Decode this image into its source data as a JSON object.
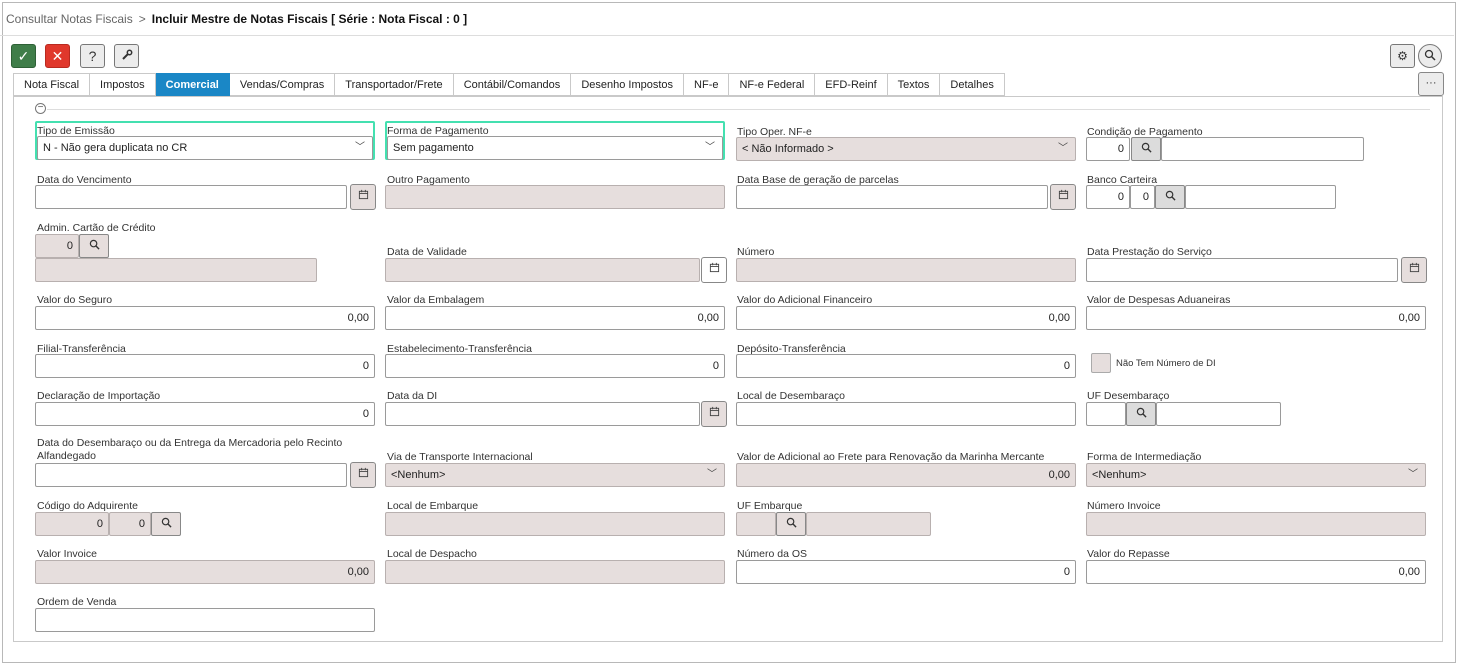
{
  "breadcrumb": {
    "parent": "Consultar Notas Fiscais",
    "separator": ">",
    "current": "Incluir Mestre de Notas Fiscais [ Série : Nota Fiscal : 0 ]"
  },
  "toolbar": {
    "ok": "✓",
    "cancel": "✕",
    "help": "?",
    "tools": "⚙",
    "gear": "⚙",
    "search": "⌕",
    "more": "···"
  },
  "tabs": [
    "Nota Fiscal",
    "Impostos",
    "Comercial",
    "Vendas/Compras",
    "Transportador/Frete",
    "Contábil/Comandos",
    "Desenho Impostos",
    "NF-e",
    "NF-e Federal",
    "EFD-Reinf",
    "Textos",
    "Detalhes"
  ],
  "active_tab": "Comercial",
  "collapse": "−",
  "icons": {
    "calendar": "📅",
    "search": "🔍",
    "caret": "﹀"
  },
  "fields": {
    "tipo_emissao": {
      "label": "Tipo de Emissão",
      "value": "N - Não gera duplicata no CR"
    },
    "forma_pagamento": {
      "label": "Forma de Pagamento",
      "value": "Sem pagamento"
    },
    "tipo_oper_nfe": {
      "label": "Tipo Oper. NF-e",
      "value": "< Não Informado >"
    },
    "condicao_pagamento": {
      "label": "Condição de Pagamento",
      "code": "0",
      "desc": ""
    },
    "data_vencimento": {
      "label": "Data do Vencimento",
      "value": ""
    },
    "outro_pagamento": {
      "label": "Outro Pagamento",
      "value": ""
    },
    "data_base_parcelas": {
      "label": "Data Base de geração de parcelas",
      "value": ""
    },
    "banco_carteira": {
      "label": "Banco Carteira",
      "code1": "0",
      "code2": "0",
      "desc": ""
    },
    "admin_cartao": {
      "label": "Admin. Cartão de Crédito",
      "code": "0",
      "desc": ""
    },
    "data_validade": {
      "label": "Data de Validade",
      "value": ""
    },
    "numero": {
      "label": "Número",
      "value": ""
    },
    "data_prestacao": {
      "label": "Data Prestação do Serviço",
      "value": ""
    },
    "valor_seguro": {
      "label": "Valor do Seguro",
      "value": "0,00"
    },
    "valor_embalagem": {
      "label": "Valor da Embalagem",
      "value": "0,00"
    },
    "valor_adicional_financeiro": {
      "label": "Valor do Adicional Financeiro",
      "value": "0,00"
    },
    "valor_despesas_aduaneiras": {
      "label": "Valor de Despesas Aduaneiras",
      "value": "0,00"
    },
    "filial_transferencia": {
      "label": "Filial-Transferência",
      "value": "0"
    },
    "estabelecimento_transferencia": {
      "label": "Estabelecimento-Transferência",
      "value": "0"
    },
    "deposito_transferencia": {
      "label": "Depósito-Transferência",
      "value": "0"
    },
    "nao_tem_numero_di": {
      "label": "Não Tem Número de DI",
      "checked": false
    },
    "declaracao_importacao": {
      "label": "Declaração de Importação",
      "value": "0"
    },
    "data_di": {
      "label": "Data da DI",
      "value": ""
    },
    "local_desembaraco": {
      "label": "Local de Desembaraço",
      "value": ""
    },
    "uf_desembaraco": {
      "label": "UF Desembaraço",
      "code": "",
      "desc": ""
    },
    "data_desembaraco": {
      "label_line1": "Data do Desembaraço ou da Entrega da Mercadoria pelo Recinto",
      "label_line2": "Alfandegado",
      "value": ""
    },
    "via_transporte": {
      "label": "Via de Transporte Internacional",
      "value": "<Nenhum>"
    },
    "valor_adicional_frete": {
      "label": "Valor de Adicional ao Frete para Renovação da Marinha Mercante",
      "value": "0,00"
    },
    "forma_intermediacao": {
      "label": "Forma de Intermediação",
      "value": "<Nenhum>"
    },
    "codigo_adquirente": {
      "label": "Código do Adquirente",
      "code1": "0",
      "code2": "0"
    },
    "local_embarque": {
      "label": "Local de Embarque",
      "value": ""
    },
    "uf_embarque": {
      "label": "UF Embarque",
      "code": "",
      "desc": ""
    },
    "numero_invoice": {
      "label": "Número Invoice",
      "value": ""
    },
    "valor_invoice": {
      "label": "Valor Invoice",
      "value": "0,00"
    },
    "local_despacho": {
      "label": "Local de Despacho",
      "value": ""
    },
    "numero_os": {
      "label": "Número da OS",
      "value": "0"
    },
    "valor_repasse": {
      "label": "Valor do Repasse",
      "value": "0,00"
    },
    "ordem_venda": {
      "label": "Ordem de Venda",
      "value": ""
    }
  },
  "colors": {
    "accent": "#1a87c6",
    "ok": "#3f7d49",
    "cancel": "#e0382c",
    "disabled": "#e6dedd",
    "highlight": "#44e0b0"
  }
}
